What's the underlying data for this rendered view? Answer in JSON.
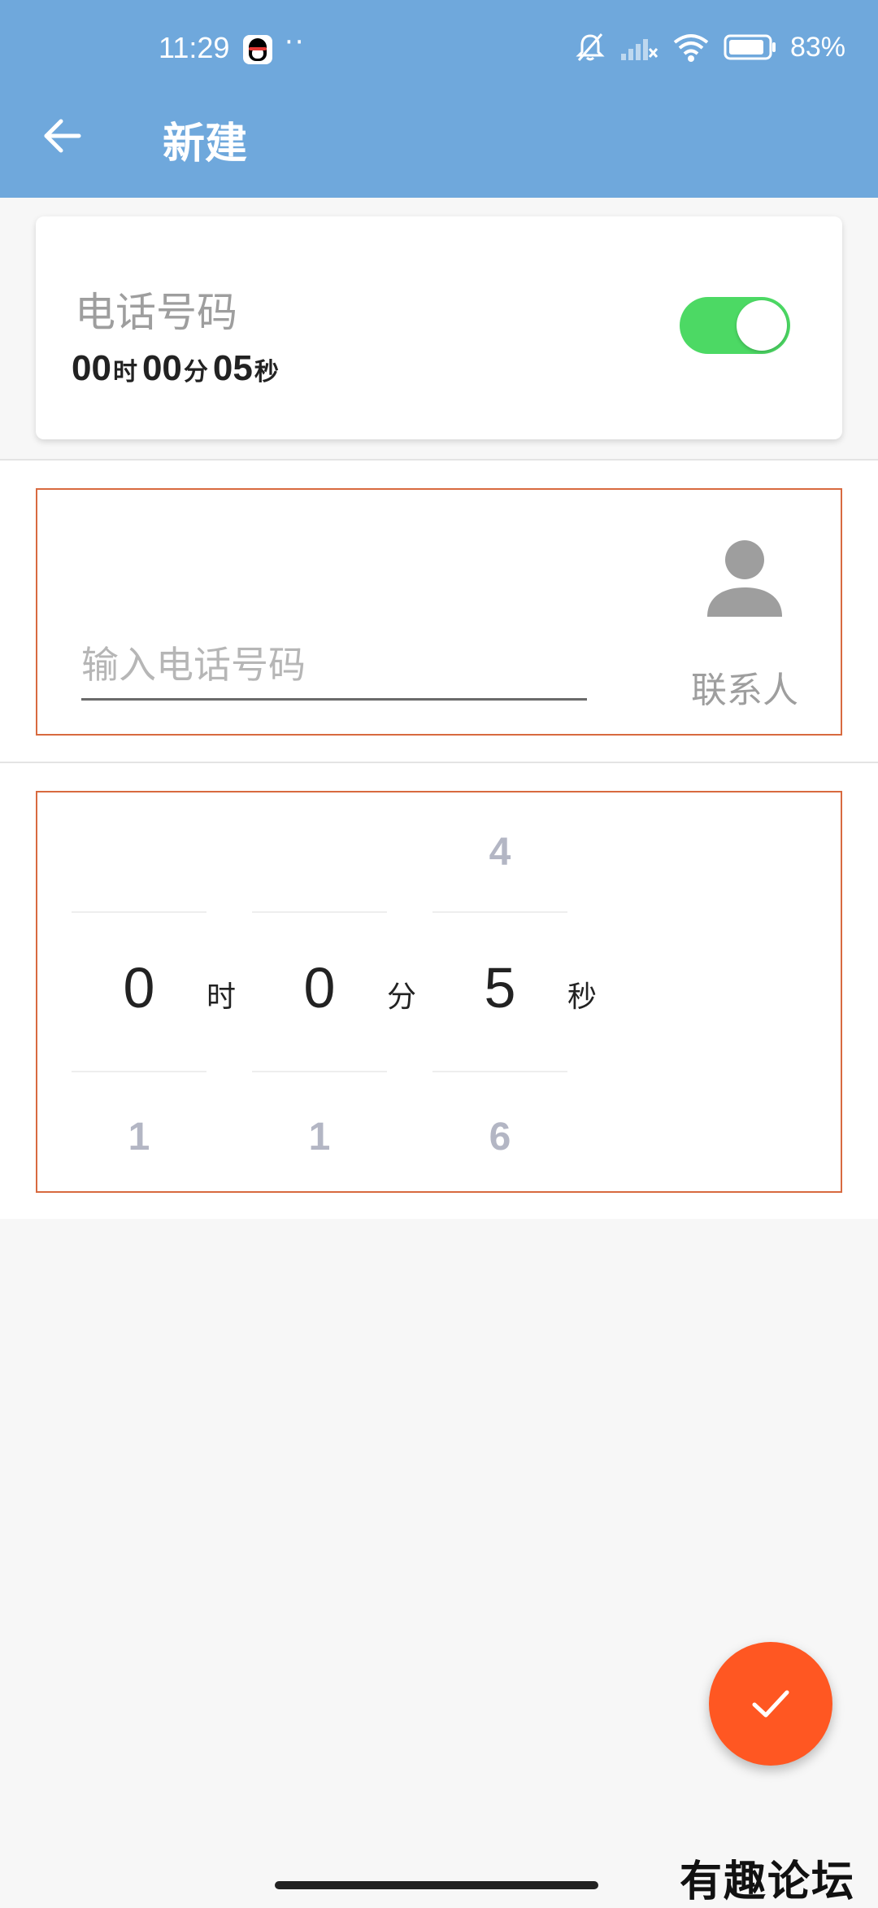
{
  "status_bar": {
    "time": "11:29",
    "dots": "··",
    "battery_percent": "83%"
  },
  "app_bar": {
    "title": "新建"
  },
  "card": {
    "title": "电话号码",
    "hours": "00",
    "hour_unit": "时",
    "minutes": "00",
    "minute_unit": "分",
    "seconds": "05",
    "second_unit": "秒",
    "switch_on": true,
    "switch_color": "#4cd964"
  },
  "phone": {
    "placeholder": "输入电话号码",
    "value": "",
    "contact_label": "联系人"
  },
  "picker": {
    "hours": {
      "prev": "",
      "selected": "0",
      "next": "1",
      "unit": "时"
    },
    "minutes": {
      "prev": "",
      "selected": "0",
      "next": "1",
      "unit": "分"
    },
    "seconds": {
      "prev": "4",
      "selected": "5",
      "next": "6",
      "unit": "秒"
    }
  },
  "fab": {
    "icon": "check-icon",
    "color": "#ff5722"
  },
  "watermark": "有趣论坛",
  "colors": {
    "app_bar": "#6fa8dc",
    "outline": "#d86a3f"
  }
}
